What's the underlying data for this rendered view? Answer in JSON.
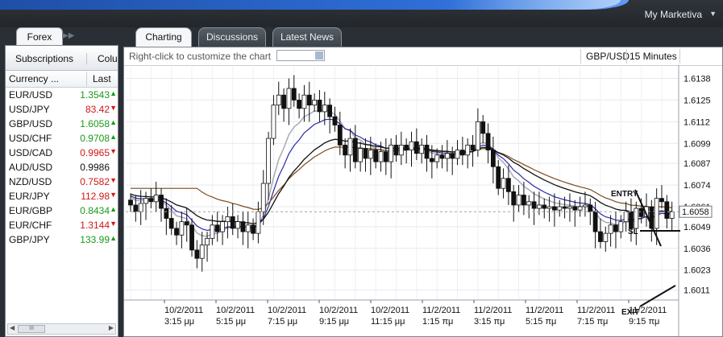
{
  "app": {
    "brand": "My Marketiva"
  },
  "left": {
    "tab": "Forex",
    "header_buttons": [
      "Subscriptions",
      "Colu"
    ],
    "columns": {
      "currency": "Currency ...",
      "last": "Last"
    },
    "rows": [
      {
        "symbol": "EUR/USD",
        "last": "1.3543",
        "dir": "up"
      },
      {
        "symbol": "USD/JPY",
        "last": "83.42",
        "dir": "down"
      },
      {
        "symbol": "GBP/USD",
        "last": "1.6058",
        "dir": "up"
      },
      {
        "symbol": "USD/CHF",
        "last": "0.9708",
        "dir": "up"
      },
      {
        "symbol": "USD/CAD",
        "last": "0.9965",
        "dir": "down"
      },
      {
        "symbol": "AUD/USD",
        "last": "0.9986",
        "dir": "flat"
      },
      {
        "symbol": "NZD/USD",
        "last": "0.7582",
        "dir": "down"
      },
      {
        "symbol": "EUR/JPY",
        "last": "112.98",
        "dir": "down"
      },
      {
        "symbol": "EUR/GBP",
        "last": "0.8434",
        "dir": "up"
      },
      {
        "symbol": "EUR/CHF",
        "last": "1.3144",
        "dir": "down"
      },
      {
        "symbol": "GBP/JPY",
        "last": "133.99",
        "dir": "up"
      }
    ],
    "scroll_thumb": "III"
  },
  "tabs": [
    "Charting",
    "Discussions",
    "Latest News"
  ],
  "chart_toolbar": {
    "hint": "Right-click to customize the chart",
    "pair": "GBP/USD",
    "timeframe": "15 Minutes"
  },
  "chart_data": {
    "type": "candlestick",
    "y_ticks": [
      "1.6138",
      "1.6125",
      "1.6112",
      "1.6099",
      "1.6087",
      "1.6074",
      "1.6061",
      "1.6049",
      "1.6036",
      "1.6023",
      "1.6011"
    ],
    "y_range": [
      1.6005,
      1.6145
    ],
    "current_price": "1.6058",
    "x_ticks": [
      {
        "date": "10/2/2011",
        "time": "3:15 μμ"
      },
      {
        "date": "10/2/2011",
        "time": "5:15 μμ"
      },
      {
        "date": "10/2/2011",
        "time": "7:15 μμ"
      },
      {
        "date": "10/2/2011",
        "time": "9:15 μμ"
      },
      {
        "date": "10/2/2011",
        "time": "11:15 μμ"
      },
      {
        "date": "11/2/2011",
        "time": "1:15 πμ"
      },
      {
        "date": "11/2/2011",
        "time": "3:15 πμ"
      },
      {
        "date": "11/2/2011",
        "time": "5:15 πμ"
      },
      {
        "date": "11/2/2011",
        "time": "7:15 πμ"
      },
      {
        "date": "11/2/2011",
        "time": "9:15 πμ"
      }
    ],
    "annotations": [
      "ENTRY",
      "SL",
      "EXIT"
    ],
    "closes": [
      1.6062,
      1.6058,
      1.6063,
      1.6066,
      1.6064,
      1.6068,
      1.606,
      1.6054,
      1.6048,
      1.6044,
      1.6052,
      1.605,
      1.6035,
      1.603,
      1.6038,
      1.6042,
      1.605,
      1.6046,
      1.6052,
      1.6055,
      1.6048,
      1.6052,
      1.6046,
      1.605,
      1.6045,
      1.6058,
      1.6075,
      1.6102,
      1.6122,
      1.6128,
      1.612,
      1.6132,
      1.6125,
      1.612,
      1.6128,
      1.6122,
      1.6125,
      1.6118,
      1.6122,
      1.6115,
      1.611,
      1.6098,
      1.6092,
      1.6102,
      1.6088,
      1.6096,
      1.609,
      1.6095,
      1.6088,
      1.6094,
      1.6088,
      1.6098,
      1.6092,
      1.6098,
      1.6095,
      1.61,
      1.6093,
      1.6098,
      1.609,
      1.6088,
      1.6092,
      1.609,
      1.6093,
      1.609,
      1.6095,
      1.6092,
      1.6098,
      1.6095,
      1.6112,
      1.6105,
      1.6095,
      1.6085,
      1.6072,
      1.6078,
      1.607,
      1.6062,
      1.6068,
      1.6062,
      1.6064,
      1.606,
      1.6062,
      1.606,
      1.6061,
      1.6059,
      1.6061,
      1.606,
      1.6061,
      1.6059,
      1.6061,
      1.6062,
      1.6058,
      1.6046,
      1.604,
      1.6045,
      1.605,
      1.6046,
      1.6052,
      1.6058,
      1.6048,
      1.606,
      1.6055,
      1.6061,
      1.6048,
      1.6066,
      1.6064,
      1.6054,
      1.6058
    ]
  }
}
